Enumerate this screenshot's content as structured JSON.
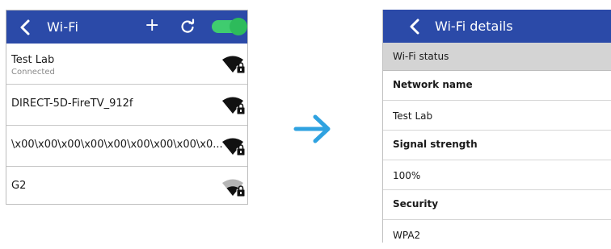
{
  "left_screen": {
    "header": {
      "title": "Wi-Fi",
      "add_symbol": "+",
      "toggle_state": "on"
    },
    "networks": [
      {
        "ssid": "Test Lab",
        "status": "Connected",
        "signal_icon": "wifi-lock-icon"
      },
      {
        "ssid": "DIRECT-5D-FireTV_912f",
        "status": "",
        "signal_icon": "wifi-lock-icon"
      },
      {
        "ssid": "\\x00\\x00\\x00\\x00\\x00\\x00\\x00\\x00\\x0...",
        "status": "",
        "signal_icon": "wifi-lock-icon"
      },
      {
        "ssid": "G2",
        "status": "",
        "signal_icon": "wifi-lock-weak-icon"
      }
    ]
  },
  "right_screen": {
    "header": {
      "title": "Wi-Fi details"
    },
    "section": "Wi-Fi status",
    "fields": [
      {
        "label": "Network name",
        "value": "Test Lab"
      },
      {
        "label": "Signal strength",
        "value": "100%"
      },
      {
        "label": "Security",
        "value": "WPA2"
      }
    ]
  },
  "colors": {
    "header_bg": "#2b4aa8",
    "toggle_on": "#3fcc6f",
    "arrow": "#2fa2e0",
    "status_bg": "#d4d4d4"
  }
}
